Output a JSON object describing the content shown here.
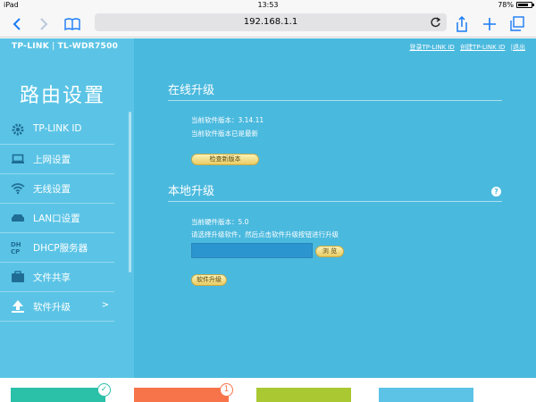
{
  "status_bar": {
    "device": "iPad",
    "time": "13:53",
    "battery": "78%"
  },
  "browser": {
    "url": "192.168.1.1"
  },
  "router": {
    "brand": "TP-LINK",
    "model": "TL-WDR7500",
    "sidebar_title": "路由设置",
    "top_links": [
      "登录TP-LINK ID",
      "创建TP-LINK ID",
      "|退出"
    ],
    "nav": [
      {
        "label": "TP-LINK ID",
        "icon": "gear-icon"
      },
      {
        "label": "上网设置",
        "icon": "laptop-icon"
      },
      {
        "label": "无线设置",
        "icon": "wifi-icon"
      },
      {
        "label": "LAN口设置",
        "icon": "router-icon"
      },
      {
        "label": "DHCP服务器",
        "icon": "dhcp-icon"
      },
      {
        "label": "文件共享",
        "icon": "folder-icon"
      },
      {
        "label": "软件升级",
        "icon": "upload-icon",
        "chevron": ">"
      }
    ]
  },
  "online_upgrade": {
    "title": "在线升级",
    "current_version": "当前软件版本：3.14.11",
    "status": "当前软件版本已是最新",
    "check_button": "检查新版本"
  },
  "local_upgrade": {
    "title": "本地升级",
    "help": "?",
    "hardware_version": "当前硬件版本：5.0",
    "instruction": "请选择升级软件，然后点击软件升级按钮进行升级",
    "file_value": "",
    "browse_button": "浏 览",
    "upgrade_button": "软件升级"
  },
  "tiles": [
    {
      "color": "#2bc0a8",
      "badge": "✓"
    },
    {
      "color": "#f7744a",
      "badge": "1"
    },
    {
      "color": "#a9c832",
      "badge": ""
    },
    {
      "color": "#5cc3e6",
      "badge": ""
    }
  ]
}
